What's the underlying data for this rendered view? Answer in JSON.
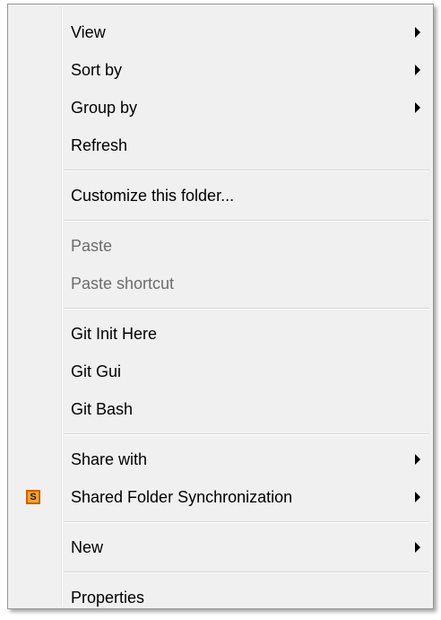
{
  "menu": {
    "view": "View",
    "sort_by": "Sort by",
    "group_by": "Group by",
    "refresh": "Refresh",
    "customize": "Customize this folder...",
    "paste": "Paste",
    "paste_shortcut": "Paste shortcut",
    "git_init": "Git Init Here",
    "git_gui": "Git Gui",
    "git_bash": "Git Bash",
    "share_with": "Share with",
    "shared_sync": "Shared Folder Synchronization",
    "shared_sync_icon_glyph": "S",
    "new": "New",
    "properties": "Properties"
  },
  "icons": {
    "submenu_arrow": "chevron-right-icon",
    "shared_sync": "shared-folder-sync-icon"
  },
  "colors": {
    "menu_background": "#f0f0f0",
    "disabled_text": "#6d6d6d",
    "sync_icon": "#f6a623"
  }
}
